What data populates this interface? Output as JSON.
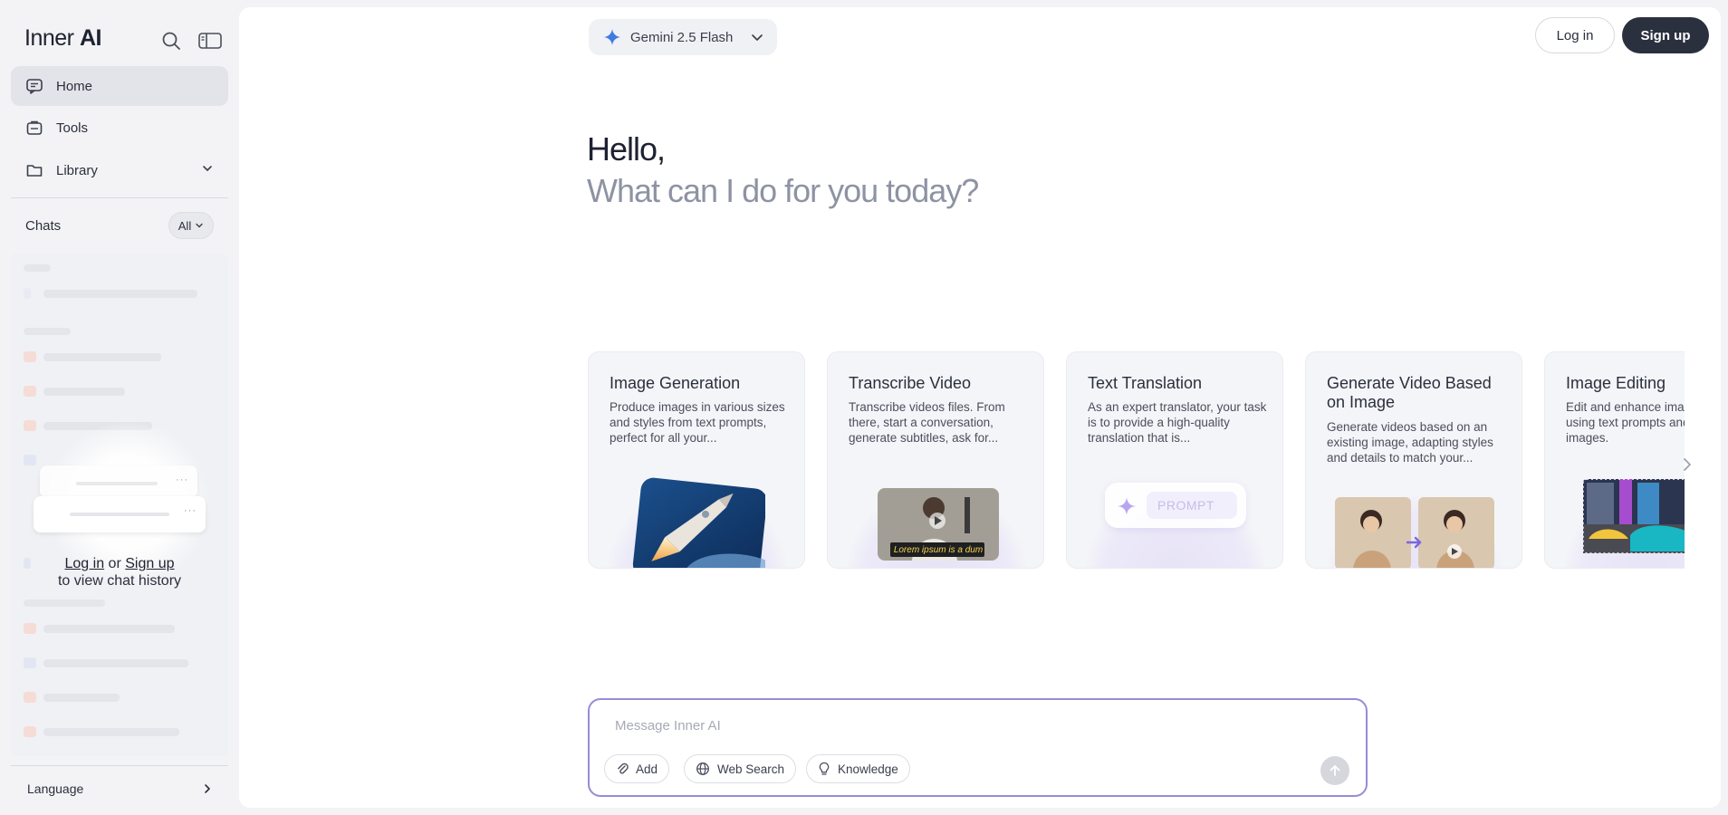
{
  "app": {
    "logo_light": "Inner",
    "logo_bold": "AI"
  },
  "sidebar": {
    "nav": [
      {
        "label": "Home",
        "icon": "chat-icon",
        "active": true
      },
      {
        "label": "Tools",
        "icon": "tools-icon",
        "active": false
      },
      {
        "label": "Library",
        "icon": "folder-icon",
        "active": false
      }
    ],
    "chats_label": "Chats",
    "chats_filter": "All",
    "login_link": "Log in",
    "or_text": "or",
    "signup_link": "Sign up",
    "history_hint": "to view chat history",
    "language_label": "Language"
  },
  "header": {
    "model_name": "Gemini 2.5 Flash",
    "login_label": "Log in",
    "signup_label": "Sign up"
  },
  "hero": {
    "greeting": "Hello,",
    "prompt": "What can I do for you today?"
  },
  "tools": [
    {
      "title": "Image Generation",
      "description": "Produce images in various sizes and styles from text prompts, perfect for all your..."
    },
    {
      "title": "Transcribe Video",
      "description": "Transcribe videos files. From there, start a conversation, generate subtitles, ask for..."
    },
    {
      "title": "Text Translation",
      "description": "As an expert translator, your task is to provide a high-quality translation that is..."
    },
    {
      "title": "Generate Video Based on Image",
      "description": "Generate videos based on an existing image, adapting styles and details to match your..."
    },
    {
      "title": "Image Editing",
      "description": "Edit and enhance images with AI using text prompts and reference images."
    }
  ],
  "card_art_text": {
    "subtitle_sample": "Lorem ipsum is a dum",
    "prompt_sample": "PROMPT"
  },
  "composer": {
    "placeholder": "Message Inner AI",
    "add_label": "Add",
    "web_search_label": "Web Search",
    "knowledge_label": "Knowledge"
  },
  "colors": {
    "accent": "#9b8ad6",
    "dark_button": "#2b303f",
    "gemini_blue": "#3f7be0"
  }
}
